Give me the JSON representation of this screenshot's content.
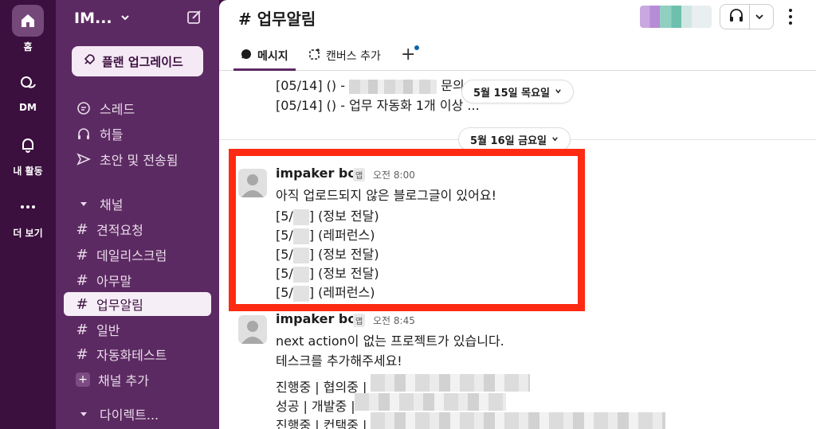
{
  "rail": {
    "home": "홈",
    "dm": "DM",
    "activity": "내 활동",
    "more": "더 보기"
  },
  "sidebar": {
    "workspace": "IM...",
    "upgrade": "플랜 업그레이드",
    "threads": "스레드",
    "huddles": "허들",
    "drafts": "초안 및 전송됨",
    "channels_header": "채널",
    "channels": [
      "견적요청",
      "데일리스크럼",
      "아무말",
      "업무알림",
      "일반",
      "자동화테스트"
    ],
    "add_channel": "채널 추가",
    "dm_header": "다이렉트..."
  },
  "main": {
    "channel_title": "# 업무알림",
    "tabs": {
      "messages": "메시지",
      "canvas": "캔버스 추가"
    },
    "prev_line1": "[05/14] () -",
    "prev_line1_tail": "문의",
    "prev_line2": "[05/14] () - 업무 자동화 1개 이상 ...",
    "date1": "5월 15일 목요일",
    "date2": "5월 16일 금요일",
    "msg1": {
      "sender": "impaker bot",
      "badge": "앱",
      "time": "오전 8:00",
      "text": "아직 업로드되지 않은 블로그글이 있어요!",
      "items": [
        {
          "prefix": "[5/",
          "suffix": "] (정보 전달)"
        },
        {
          "prefix": "[5/",
          "suffix": "] (레퍼런스)"
        },
        {
          "prefix": "[5/",
          "suffix": "] (정보 전달)"
        },
        {
          "prefix": "[5/",
          "suffix": "] (정보 전달)"
        },
        {
          "prefix": "[5/",
          "suffix": "] (레퍼런스)"
        }
      ]
    },
    "msg2": {
      "sender": "impaker bot",
      "badge": "앱",
      "time": "오전 8:45",
      "line1": "next action이 없는 프로젝트가 있습니다.",
      "line2": "테스크를 추가해주세요!",
      "rows": [
        "진행중 | 협의중 |",
        "성공 | 개발중 |",
        "진행중 | 컨택중 |"
      ]
    }
  },
  "colors": {
    "rail": "#3b0f3e",
    "sidebar": "#5c2a62",
    "highlight": "#ff2a12"
  }
}
